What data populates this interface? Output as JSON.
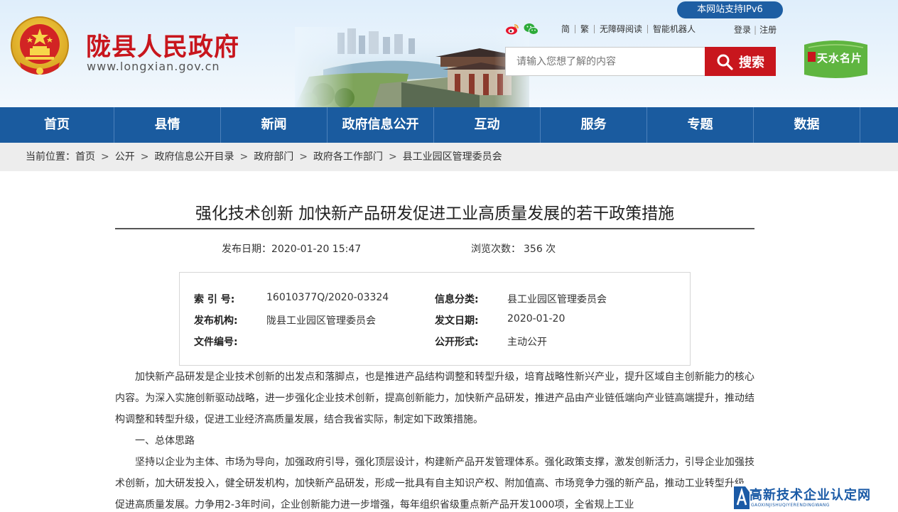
{
  "site": {
    "title": "陇县人民政府",
    "url": "www.longxian.gov.cn",
    "ipv6": "本网站支持IPv6"
  },
  "topbar": {
    "links": [
      "简",
      "繁",
      "无障碍阅读",
      "智能机器人"
    ],
    "login": "登录",
    "divider": "|",
    "register": "注册",
    "icons": [
      "weibo-icon",
      "wechat-icon"
    ]
  },
  "search": {
    "placeholder": "请输入您想了解的内容",
    "button": "搜索"
  },
  "badge_logo": {
    "text": "天水名片"
  },
  "nav": [
    "首页",
    "县情",
    "新闻",
    "政府信息公开",
    "互动",
    "服务",
    "专题",
    "数据"
  ],
  "breadcrumb": {
    "prefix": "当前位置：",
    "items": [
      "首页",
      "公开",
      "政府信息公开目录",
      "政府部门",
      "政府各工作部门",
      "县工业园区管理委员会"
    ],
    "separator": ">"
  },
  "article": {
    "title": "强化技术创新 加快新产品研发促进工业高质量发展的若干政策措施",
    "publish_label": "发布日期：",
    "publish_value": "2020-01-20 15:47",
    "views_label": "浏览次数：",
    "views_value": "356 次"
  },
  "info": {
    "index_label": "索 引 号:",
    "index_value": "16010377Q/2020-03324",
    "category_label": "信息分类:",
    "category_value": "县工业园区管理委员会",
    "org_label": "发布机构:",
    "org_value": "陇县工业园区管理委员会",
    "date_label": "发文日期:",
    "date_value": "2020-01-20",
    "docno_label": "文件编号:",
    "docno_value": "",
    "form_label": "公开形式:",
    "form_value": "主动公开"
  },
  "body": [
    "加快新产品研发是企业技术创新的出发点和落脚点，也是推进产品结构调整和转型升级，培育战略性新兴产业，提升区域自主创新能力的核心内容。为深入实施创新驱动战略，进一步强化企业技术创新，提高创新能力，加快新产品研发，推进产品由产业链低端向产业链高端提升，推动结构调整和转型升级，促进工业经济高质量发展，结合我省实际，制定如下政策措施。",
    "一、总体思路",
    "坚持以企业为主体、市场为导向，加强政府引导，强化顶层设计，构建新产品开发管理体系。强化政策支撑，激发创新活力，引导企业加强技术创新，加大研发投入，健全研发机构，加快新产品研发，形成一批具有自主知识产权、附加值高、市场竞争力强的新产品，推动工业转型升级，促进高质量发展。力争用2-3年时间，企业创新能力进一步增强，每年组织省级重点新产品开发1000项，全省规上工业"
  ],
  "watermark": {
    "main": "高新技术企业认定网",
    "sub": "GAOXINJISHUQIYERENDINGWANG"
  },
  "colors": {
    "brand_red": "#c8161d",
    "nav_blue": "#1a5b9f",
    "ipv6_blue": "#1d5ea3",
    "logo_green": "#5fb540"
  }
}
